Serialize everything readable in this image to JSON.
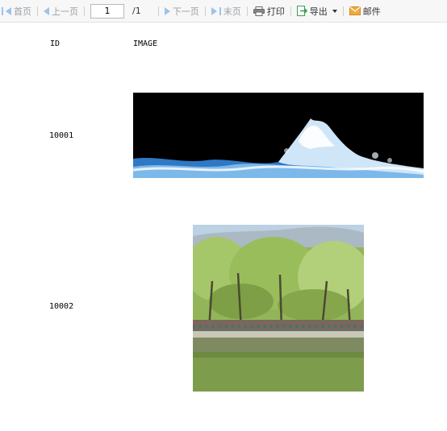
{
  "toolbar": {
    "first_page": "首页",
    "prev_page": "上一页",
    "page_value": "1",
    "page_total": "/1",
    "next_page": "下一页",
    "last_page": "末页",
    "print": "打印",
    "export": "导出",
    "mail": "邮件"
  },
  "table": {
    "headers": [
      "ID",
      "IMAGE"
    ],
    "rows": [
      {
        "id": "10001",
        "image": "ocean-wave-splash"
      },
      {
        "id": "10002",
        "image": "lake-willow-trees"
      }
    ]
  },
  "colors": {
    "toolbar_bg": "#f7f7f7",
    "nav_disabled": "#9cc3e8",
    "export_icon": "#3aa055",
    "mail_icon": "#f2a93b"
  }
}
